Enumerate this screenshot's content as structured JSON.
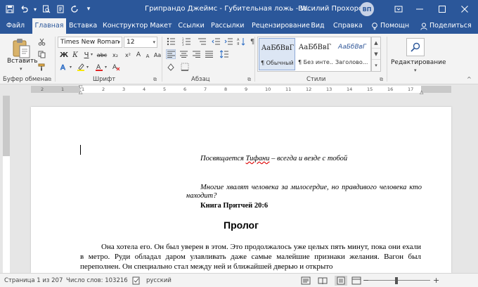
{
  "titlebar": {
    "title": "Грипрандо Джеймс - Губительная ложь - W...",
    "user_name": "Василий Прохоров",
    "avatar_initials": "ВП",
    "icons": [
      "save-icon",
      "undo-icon",
      "print-preview-icon",
      "quick-print-icon",
      "redo-icon",
      "qat-customize-icon",
      "ribbon-display-icon",
      "minimize-icon",
      "maximize-icon",
      "close-icon"
    ]
  },
  "tabs": [
    {
      "label": "Файл"
    },
    {
      "label": "Главная"
    },
    {
      "label": "Вставка"
    },
    {
      "label": "Конструктор"
    },
    {
      "label": "Макет"
    },
    {
      "label": "Ссылки"
    },
    {
      "label": "Рассылки"
    },
    {
      "label": "Рецензирование"
    },
    {
      "label": "Вид"
    },
    {
      "label": "Справка"
    }
  ],
  "tabs_right": {
    "help_label": "Помощн",
    "share_label": "Поделиться"
  },
  "ribbon": {
    "clipboard": {
      "paste_label": "Вставить",
      "group_label": "Буфер обмена"
    },
    "font": {
      "font_name": "Times New Roman",
      "font_size": "12",
      "group_label": "Шрифт",
      "bold": "Ж",
      "italic": "К",
      "underline": "Ч",
      "strike": "abc",
      "sub": "x₂",
      "sup": "x²",
      "case": "Aa",
      "grow": "A",
      "shrink": "A",
      "color_a": "A",
      "accent_red": "#e02424",
      "accent_yellow": "#f7e600"
    },
    "paragraph": {
      "group_label": "Абзац"
    },
    "styles": {
      "group_label": "Стили",
      "items": [
        {
          "sample": "АаБбВвГ",
          "name": "¶ Обычный"
        },
        {
          "sample": "АаБбВвГ",
          "name": "¶ Без инте..."
        },
        {
          "sample": "АаБбВвГ",
          "name": "Заголово..."
        }
      ]
    },
    "editing": {
      "label": "Редактирование"
    }
  },
  "ruler": {
    "numbers": [
      "2",
      "1",
      "1",
      "2",
      "3",
      "4",
      "5",
      "6",
      "7",
      "8",
      "9",
      "10",
      "11",
      "12",
      "13",
      "14",
      "15",
      "16",
      "17"
    ]
  },
  "document": {
    "epigraph_prefix": "Посвящается ",
    "epigraph_name": "Тифани",
    "epigraph_suffix": " – всегда и везде с тобой",
    "quote": "Многие хвалят человека за милосердие, но правдивого человека кто находит?",
    "source": "Книга Притчей 20:6",
    "heading": "Пролог",
    "body": "Она хотела его. Он был уверен в этом. Это продолжалось уже целых пять минут, пока они ехали в метро. Руди обладал даром улавливать даже самые малейшие признаки желания. Вагон был переполнен. Он специально стал между ней и ближайшей дверью и открыто"
  },
  "statusbar": {
    "page": "Страница 1 из 207",
    "words": "Число слов: 103216",
    "language": "русский",
    "zoom_fraction": 0.45
  }
}
